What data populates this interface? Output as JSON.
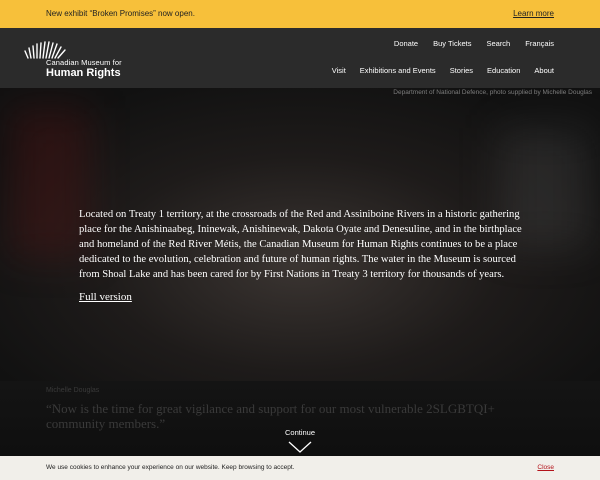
{
  "announcement": {
    "message": "New exhibit “Broken Promises” now open.",
    "link": "Learn more"
  },
  "header": {
    "logo": {
      "line1": "Canadian Museum for",
      "line2": "Human Rights"
    },
    "utility_nav": [
      "Donate",
      "Buy Tickets",
      "Search",
      "Français"
    ],
    "main_nav": [
      "Visit",
      "Exhibitions and Events",
      "Stories",
      "Education",
      "About"
    ]
  },
  "hero": {
    "photo_credit": "Department of National Defence, photo supplied by Michelle Douglas",
    "land_acknowledgement": "Located on Treaty 1 territory, at the crossroads of the Red and Assiniboine Rivers in a historic gathering place for the Anishinaabeg, Ininewak, Anishinewak, Dakota Oyate and Denesuline, and in the birthplace and homeland of the Red River Métis, the Canadian Museum for Human Rights continues to be a place dedicated to the evolution, celebration and future of human rights. The water in the Museum is sourced from Shoal Lake and has been cared for by First Nations in Treaty 3 territory for thousands of years.",
    "full_version_link": "Full version",
    "quote_author": "Michelle Douglas",
    "quote": "“Now is the time for great vigilance and support for our most vulnerable 2SLGBTQI+ community members.”",
    "continue_label": "Continue"
  },
  "cookie_banner": {
    "text": "We use cookies to enhance your experience on our website. Keep browsing to accept.",
    "close_label": "Close"
  },
  "colors": {
    "announcement_bg": "#f7c03a",
    "header_bg": "#2b2b2b",
    "cookie_close": "#b3121a"
  }
}
